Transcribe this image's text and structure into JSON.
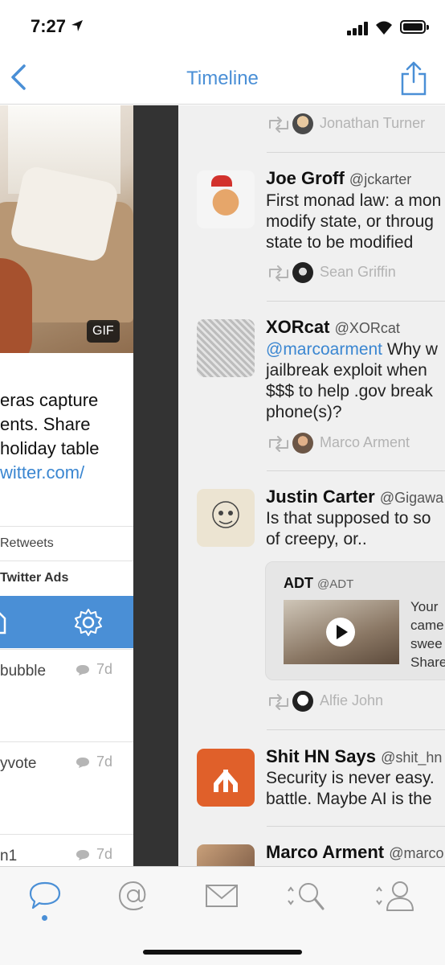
{
  "status_bar": {
    "time": "7:27"
  },
  "nav": {
    "title": "Timeline"
  },
  "left_panel": {
    "gif_badge": "GIF",
    "text_lines": [
      "eras capture",
      "ents. Share",
      "holiday table",
      "witter.com/"
    ],
    "retweets_label": "Retweets",
    "ads_label": "Twitter Ads",
    "items": [
      {
        "label": "bubble",
        "age": "7d"
      },
      {
        "label": "yvote",
        "age": "7d"
      },
      {
        "label": "n1",
        "age": "7d"
      }
    ]
  },
  "timeline": {
    "top_retweet": {
      "name": "Jonathan Turner"
    },
    "tweets": [
      {
        "name": "Joe Groff",
        "handle": "@jckarter",
        "body_lines": [
          "First monad law: a mon",
          "modify state, or throug",
          "state to be modified"
        ],
        "retweeted_by": "Sean Griffin"
      },
      {
        "name": "XORcat",
        "handle": "@XORcat",
        "mention": "@marcoarment",
        "body_lines": [
          " Why w",
          "jailbreak exploit when",
          "$$$ to help .gov break",
          "phone(s)?"
        ],
        "retweeted_by": "Marco Arment"
      },
      {
        "name": "Justin Carter",
        "handle": "@Gigawa",
        "body_lines": [
          "Is that supposed to so",
          "of creepy, or.."
        ],
        "quote": {
          "name": "ADT",
          "handle": "@ADT",
          "text_lines": [
            "Your",
            "came",
            "swee",
            "Share"
          ]
        },
        "retweeted_by": "Alfie John"
      },
      {
        "name": "Shit HN Says",
        "handle": "@shit_hn",
        "body_lines": [
          "Security is never easy.",
          "battle. Maybe AI is the"
        ]
      },
      {
        "name": "Marco Arment",
        "handle": "@marco"
      }
    ]
  },
  "tabs": [
    {
      "icon": "chat-bubble-icon",
      "active": true
    },
    {
      "icon": "at-sign-icon"
    },
    {
      "icon": "envelope-icon"
    },
    {
      "icon": "search-icon"
    },
    {
      "icon": "profile-icon"
    }
  ],
  "colors": {
    "accent": "#4a8fd6",
    "link": "#3a86d1",
    "divider": "#333333",
    "timeline_bg": "#f0f0f0"
  }
}
